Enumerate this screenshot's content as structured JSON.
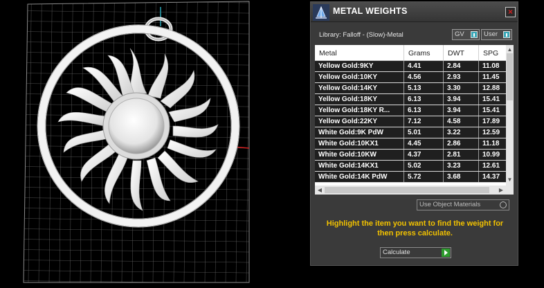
{
  "panel": {
    "title": "METAL WEIGHTS",
    "close_label": "×",
    "library_label": "Library: Falloff - (Slow)-Metal",
    "toggles": [
      {
        "label": "GV"
      },
      {
        "label": "User"
      }
    ],
    "columns": [
      "Metal",
      "Grams",
      "DWT",
      "SPG"
    ],
    "rows": [
      [
        "Yellow Gold:9KY",
        "4.41",
        "2.84",
        "11.08"
      ],
      [
        "Yellow Gold:10KY",
        "4.56",
        "2.93",
        "11.45"
      ],
      [
        "Yellow Gold:14KY",
        "5.13",
        "3.30",
        "12.88"
      ],
      [
        "Yellow Gold:18KY",
        "6.13",
        "3.94",
        "15.41"
      ],
      [
        "Yellow Gold:18KY R...",
        "6.13",
        "3.94",
        "15.41"
      ],
      [
        "Yellow Gold:22KY",
        "7.12",
        "4.58",
        "17.89"
      ],
      [
        "White Gold:9K PdW",
        "5.01",
        "3.22",
        "12.59"
      ],
      [
        "White Gold:10KX1",
        "4.45",
        "2.86",
        "11.18"
      ],
      [
        "White Gold:10KW",
        "4.37",
        "2.81",
        "10.99"
      ],
      [
        "White Gold:14KX1",
        "5.02",
        "3.23",
        "12.61"
      ],
      [
        "White Gold:14K PdW",
        "5.72",
        "3.68",
        "14.37"
      ]
    ],
    "use_object_materials_label": "Use Object Materials",
    "instructions": "Highlight the item you want to find the weight for then press calculate.",
    "calculate_label": "Calculate",
    "colors": {
      "accent_toggle": "#3aa8b8",
      "instruction_text": "#f2c200",
      "calculate_arrow": "#2e9b2e"
    }
  },
  "viewport": {
    "icons": [
      "sun-pendant-model",
      "grid-floor",
      "axis-x-red",
      "axis-y-cyan"
    ]
  }
}
